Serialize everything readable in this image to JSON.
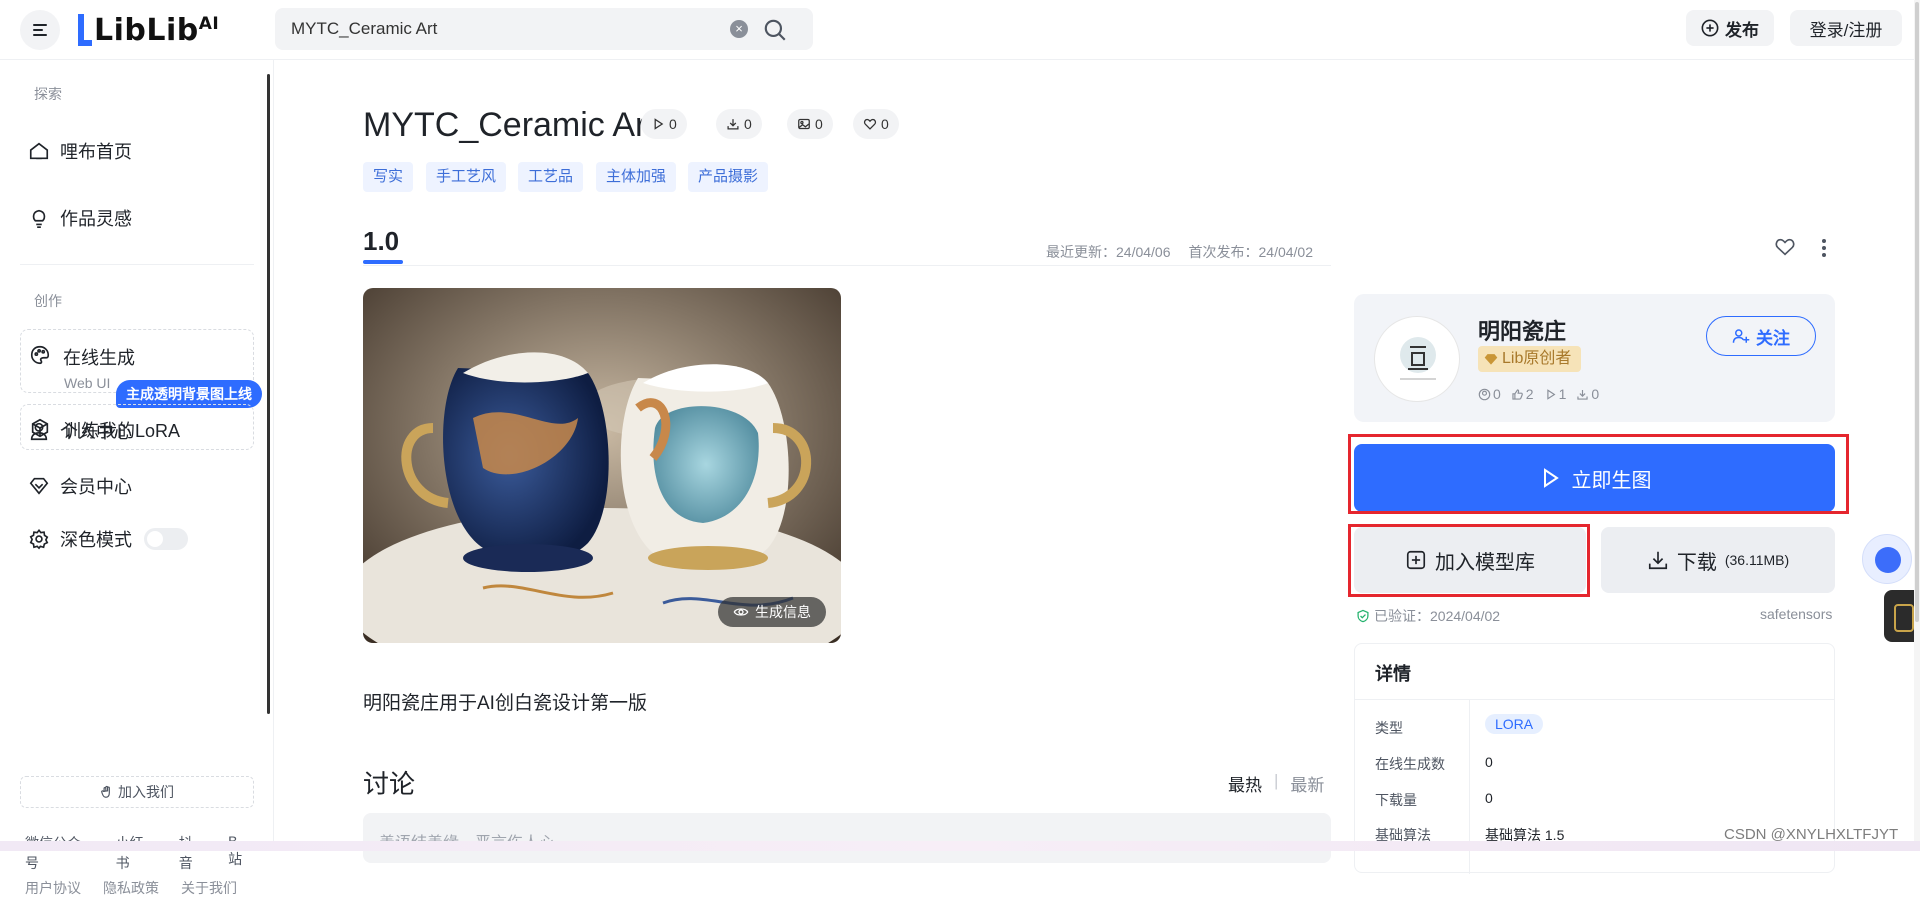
{
  "header": {
    "logo_text": "LibLib",
    "logo_sup": "AI",
    "search_value": "MYTC_Ceramic Art",
    "publish_label": "发布",
    "login_label": "登录/注册"
  },
  "sidebar": {
    "section_explore": "探索",
    "home": "哩布首页",
    "inspiration": "作品灵感",
    "section_create": "创作",
    "online_gen": "在线生成",
    "online_gen_sub": "Web UI",
    "promo_badge": "主成透明背景图上线",
    "train_lora": "训练我的LoRA",
    "personal": "个人中心",
    "member": "会员中心",
    "dark_mode": "深色模式",
    "join_us": "加入我们",
    "social_links": [
      "微信公众号",
      "小红书",
      "抖音",
      "B站"
    ],
    "legal_links": [
      "用户协议",
      "隐私政策",
      "关于我们"
    ]
  },
  "model": {
    "title": "MYTC_Ceramic Art",
    "stats": {
      "runs": "0",
      "downloads": "0",
      "images": "0",
      "likes": "0"
    },
    "tags": [
      "写实",
      "手工艺风",
      "工艺品",
      "主体加强",
      "产品摄影"
    ],
    "version": "1.0",
    "last_update": "最近更新：24/04/06",
    "first_publish": "首次发布：24/04/02",
    "gen_info_label": "生成信息",
    "description": "明阳瓷庄用于AI创白瓷设计第一版"
  },
  "discussion": {
    "title": "讨论",
    "sort_hot": "最热",
    "sort_sep": "|",
    "sort_new": "最新",
    "placeholder": "善语结善缘，恶言伤人心..."
  },
  "author": {
    "name": "明阳瓷庄",
    "badge": "Lib原创者",
    "stats": {
      "followers": "0",
      "likes": "2",
      "runs": "1",
      "downloads": "0"
    },
    "follow_label": "关注"
  },
  "actions": {
    "generate_label": "立即生图",
    "add_library_label": "加入模型库",
    "download_label": "下载",
    "download_size": "(36.11MB)",
    "verified_label": "已验证：2024/04/02",
    "format": "safetensors"
  },
  "details": {
    "title": "详情",
    "rows": [
      {
        "label": "类型",
        "value": "LORA"
      },
      {
        "label": "在线生成数",
        "value": "0"
      },
      {
        "label": "下载量",
        "value": "0"
      },
      {
        "label": "基础算法",
        "value": "基础算法 1.5"
      }
    ]
  },
  "watermark": "CSDN @XNYLHXLTFJYT",
  "colors": {
    "accent": "#2e6cff",
    "highlight_box": "#e5262e",
    "tag_bg": "#eef3ff",
    "tag_text": "#3d6ed8"
  }
}
